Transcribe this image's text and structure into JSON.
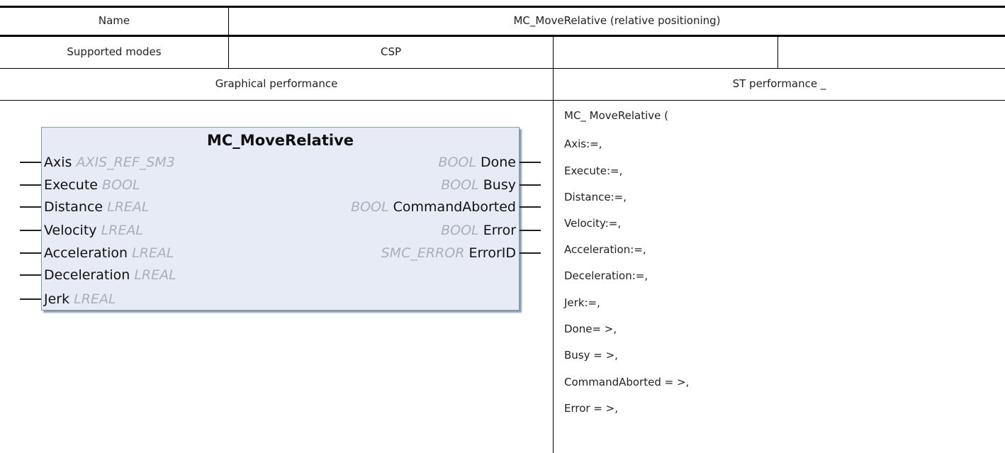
{
  "header": {
    "name_label": "Name",
    "name_value": "MC_MoveRelative (relative positioning)"
  },
  "modes": {
    "label": "Supported modes",
    "value": "CSP",
    "extra1": "",
    "extra2": ""
  },
  "sections": {
    "graphical": "Graphical performance",
    "st": "ST performance _"
  },
  "function_block": {
    "title": "MC_MoveRelative",
    "inputs": [
      {
        "name": "Axis",
        "type": "AXIS_REF_SM3"
      },
      {
        "name": "Execute",
        "type": "BOOL"
      },
      {
        "name": "Distance",
        "type": "LREAL"
      },
      {
        "name": "Velocity",
        "type": "LREAL"
      },
      {
        "name": "Acceleration",
        "type": "LREAL"
      },
      {
        "name": "Deceleration",
        "type": "LREAL"
      },
      {
        "name": "Jerk",
        "type": "LREAL"
      }
    ],
    "outputs": [
      {
        "name": "Done",
        "type": "BOOL"
      },
      {
        "name": "Busy",
        "type": "BOOL"
      },
      {
        "name": "CommandAborted",
        "type": "BOOL"
      },
      {
        "name": "Error",
        "type": "BOOL"
      },
      {
        "name": "ErrorID",
        "type": "SMC_ERROR"
      }
    ]
  },
  "st_lines": [
    "MC_ MoveRelative (",
    "Axis:=,",
    "Execute:=,",
    "Distance:=,",
    "Velocity:=,",
    "Acceleration:=,",
    "Deceleration:=,",
    "Jerk:=,",
    "Done= >,",
    "Busy = >,",
    "CommandAborted = >,",
    "Error = >,"
  ]
}
